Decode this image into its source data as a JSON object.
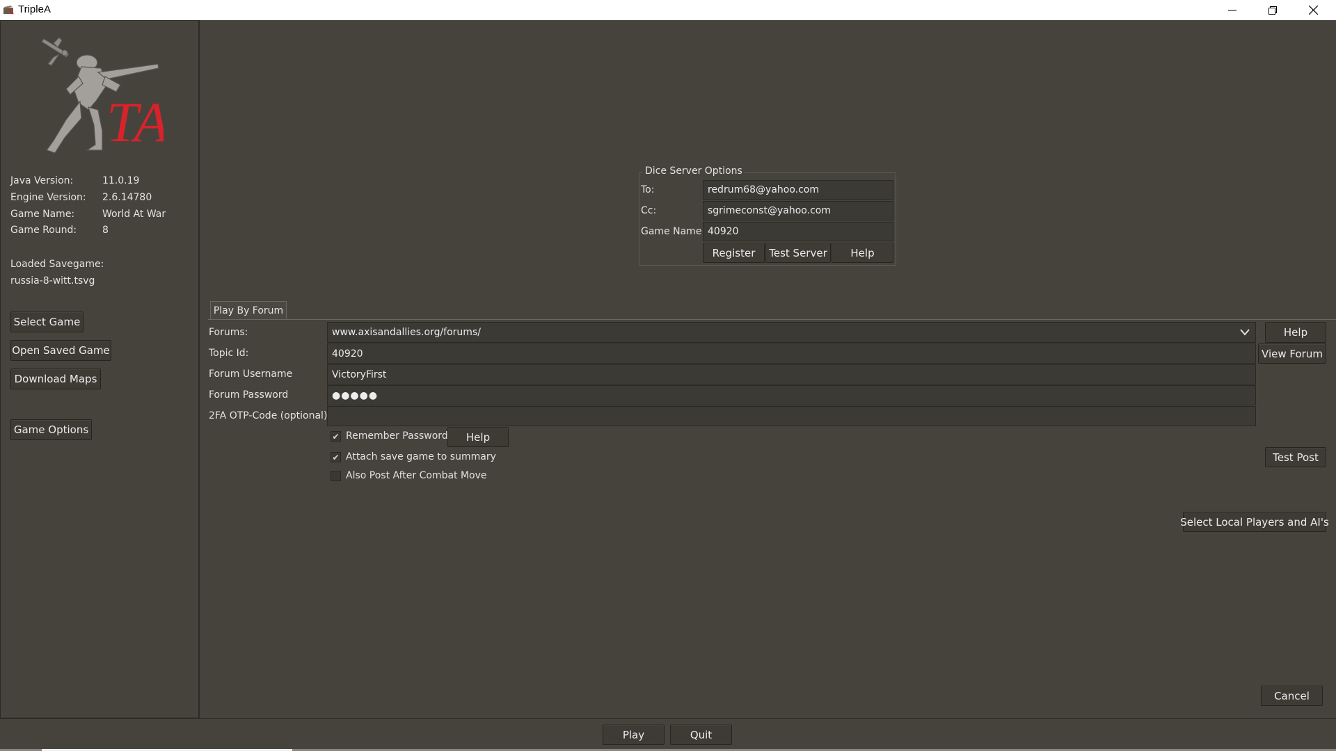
{
  "window": {
    "title": "TripleA",
    "minimize_glyph": "—",
    "restore_glyph": "❐",
    "close_glyph": "✕"
  },
  "logo": {
    "text": "TA",
    "icon": "soldier-logo-icon",
    "color": "#d8232a"
  },
  "info": {
    "java_label": "Java Version:",
    "java_value": "11.0.19",
    "engine_label": "Engine Version:",
    "engine_value": "2.6.14780",
    "game_name_label": "Game Name:",
    "game_name_value": "World At War",
    "game_round_label": "Game Round:",
    "game_round_value": "8",
    "loaded_label": "Loaded Savegame:",
    "loaded_value": "russia-8-witt.tsvg"
  },
  "sidebar_buttons": {
    "select_game": "Select Game",
    "open_saved": "Open Saved Game",
    "download_maps": "Download Maps",
    "game_options": "Game Options"
  },
  "dice": {
    "legend": "Dice Server Options",
    "to_label": "To:",
    "to_value": "redrum68@yahoo.com",
    "cc_label": "Cc:",
    "cc_value": "sgrimeconst@yahoo.com",
    "game_name_label": "Game Name:",
    "game_name_value": "40920",
    "register": "Register",
    "test_server": "Test Server",
    "help": "Help"
  },
  "forum": {
    "tab": "Play By Forum",
    "forums_label": "Forums:",
    "forums_value": "www.axisandallies.org/forums/",
    "topic_label": "Topic Id:",
    "topic_value": "40920",
    "username_label": "Forum Username",
    "username_value": "VictoryFirst",
    "password_label": "Forum Password",
    "password_value": "●●●●●",
    "otp_label": "2FA OTP-Code (optional)",
    "otp_value": "",
    "help": "Help",
    "view_forum": "View Forum",
    "remember_password": "Remember Password",
    "remember_help": "Help",
    "attach_save": "Attach save game to summary",
    "also_post": "Also Post After Combat Move",
    "test_post": "Test Post",
    "remember_checked": true,
    "attach_checked": true,
    "also_checked": false
  },
  "actions": {
    "select_local": "Select Local Players and AI's",
    "cancel": "Cancel",
    "play": "Play",
    "quit": "Quit"
  },
  "check_glyph": "✔",
  "chevron_glyph": "⌵"
}
